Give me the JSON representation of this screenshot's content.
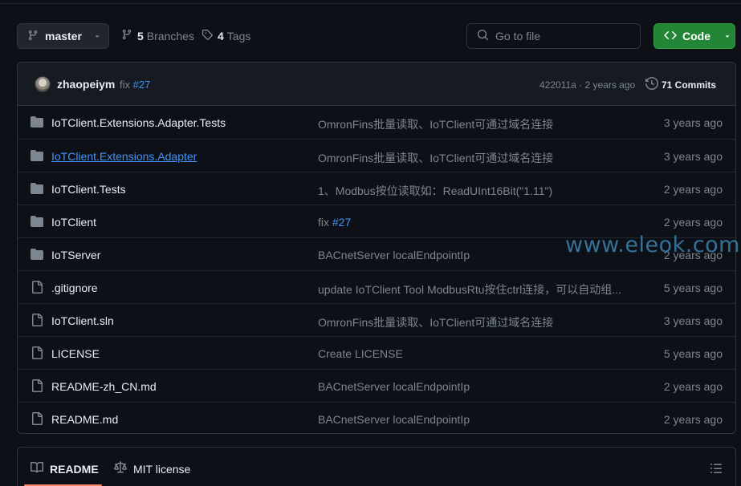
{
  "toolbar": {
    "branch_label": "master",
    "branches_count": "5",
    "branches_label": "Branches",
    "tags_count": "4",
    "tags_label": "Tags",
    "search_placeholder": "Go to file",
    "code_label": "Code"
  },
  "latest_commit": {
    "author": "zhaopeiym",
    "message": "fix",
    "message_ref": "#27",
    "hash_time": "422011a · 2 years ago",
    "commits_count": "71 Commits"
  },
  "files": [
    {
      "type": "folder",
      "name": "IoTClient.Extensions.Adapter.Tests",
      "message": "OmronFins批量读取、IoTClient可通过域名连接",
      "age": "3 years ago"
    },
    {
      "type": "folder",
      "name": "IoTClient.Extensions.Adapter",
      "message": "OmronFins批量读取、IoTClient可通过域名连接",
      "age": "3 years ago"
    },
    {
      "type": "folder",
      "name": "IoTClient.Tests",
      "message": "1、Modbus按位读取如：ReadUInt16Bit(\"1.11\")",
      "age": "2 years ago"
    },
    {
      "type": "folder",
      "name": "IoTClient",
      "message": "fix",
      "message_ref": "#27",
      "age": "2 years ago"
    },
    {
      "type": "folder",
      "name": "IoTServer",
      "message": "BACnetServer localEndpointIp",
      "age": "2 years ago"
    },
    {
      "type": "file",
      "name": ".gitignore",
      "message": "update IoTClient Tool ModbusRtu按住ctrl连接，可以自动组...",
      "age": "5 years ago"
    },
    {
      "type": "file",
      "name": "IoTClient.sln",
      "message": "OmronFins批量读取、IoTClient可通过域名连接",
      "age": "3 years ago"
    },
    {
      "type": "file",
      "name": "LICENSE",
      "message": "Create LICENSE",
      "age": "5 years ago"
    },
    {
      "type": "file",
      "name": "README-zh_CN.md",
      "message": "BACnetServer localEndpointIp",
      "age": "2 years ago"
    },
    {
      "type": "file",
      "name": "README.md",
      "message": "BACnetServer localEndpointIp",
      "age": "2 years ago"
    }
  ],
  "readme_tabs": {
    "readme_label": "README",
    "license_label": "MIT license"
  },
  "watermark": "www.eleok.com",
  "colors": {
    "background": "#0d1117",
    "link": "#4493f8",
    "code_button": "#238636",
    "muted": "#7d8590",
    "tab_underline": "#f78166"
  },
  "icons": {
    "branch": "git-branch-icon",
    "tag": "tag-icon",
    "search": "search-icon",
    "code": "code-icon",
    "history": "history-icon",
    "folder": "folder-icon",
    "file": "file-icon",
    "book": "book-icon",
    "law": "law-icon",
    "toc": "list-unordered-icon"
  }
}
